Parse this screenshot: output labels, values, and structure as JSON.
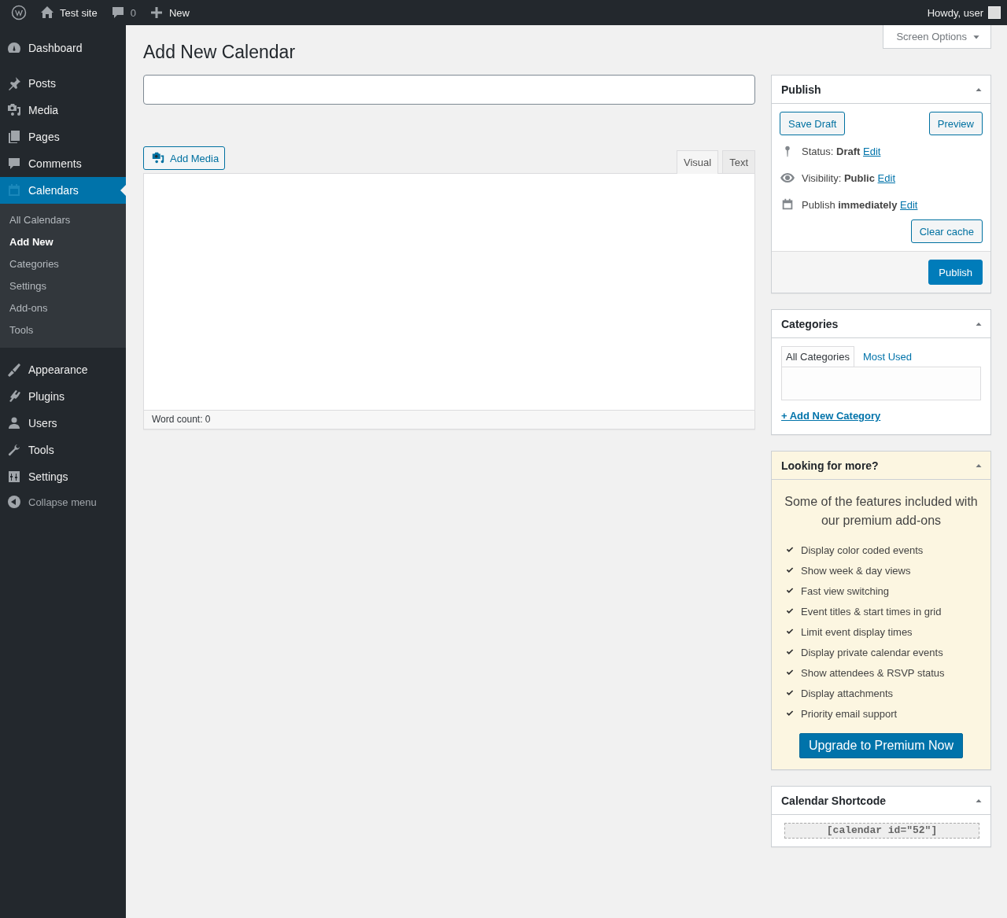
{
  "admin_bar": {
    "site_name": "Test site",
    "comments_count": "0",
    "new_label": "New",
    "greeting": "Howdy, user"
  },
  "sidebar": {
    "items": [
      {
        "label": "Dashboard",
        "selected": false
      },
      {
        "label": "Posts",
        "selected": false
      },
      {
        "label": "Media",
        "selected": false
      },
      {
        "label": "Pages",
        "selected": false
      },
      {
        "label": "Comments",
        "selected": false
      },
      {
        "label": "Calendars",
        "selected": true,
        "submenu": [
          {
            "label": "All Calendars",
            "selected": false
          },
          {
            "label": "Add New",
            "selected": true
          },
          {
            "label": "Categories",
            "selected": false
          },
          {
            "label": "Settings",
            "selected": false
          },
          {
            "label": "Add-ons",
            "selected": false
          },
          {
            "label": "Tools",
            "selected": false
          }
        ]
      },
      {
        "label": "Appearance",
        "selected": false
      },
      {
        "label": "Plugins",
        "selected": false
      },
      {
        "label": "Users",
        "selected": false
      },
      {
        "label": "Tools",
        "selected": false
      },
      {
        "label": "Settings",
        "selected": false
      }
    ],
    "collapse_label": "Collapse menu"
  },
  "screen_options": "Screen Options",
  "page_title": "Add New Calendar",
  "editor": {
    "add_media": "Add Media",
    "tabs": [
      {
        "label": "Visual",
        "selected": true
      },
      {
        "label": "Text",
        "selected": false
      }
    ],
    "word_count": "Word count: 0"
  },
  "publish": {
    "title": "Publish",
    "save_draft": "Save Draft",
    "preview": "Preview",
    "rows": [
      {
        "text": "Status: **Draft**",
        "link": "Edit"
      },
      {
        "text": "Visibility: **Public**",
        "link": "Edit"
      },
      {
        "text": "Publish **immediately**",
        "link": "Edit"
      }
    ],
    "clear_cache": "Clear cache",
    "publish_button": "Publish"
  },
  "categories": {
    "title": "Categories",
    "tabs": [
      {
        "label": "All Categories",
        "selected": true
      },
      {
        "label": "Most Used",
        "selected": false
      }
    ],
    "add_link": "+ Add New Category"
  },
  "promo": {
    "title": "Looking for more?",
    "intro": "Some of the features included with our premium add-ons",
    "features": [
      "Display color coded events",
      "Show week & day views",
      "Fast view switching",
      "Event titles & start times in grid",
      "Limit event display times",
      "Display private calendar events",
      "Show attendees & RSVP status",
      "Display attachments",
      "Priority email support"
    ],
    "button": "Upgrade to Premium Now"
  },
  "shortcode": {
    "title": "Calendar Shortcode",
    "value": "[calendar id=\"52\"]"
  }
}
